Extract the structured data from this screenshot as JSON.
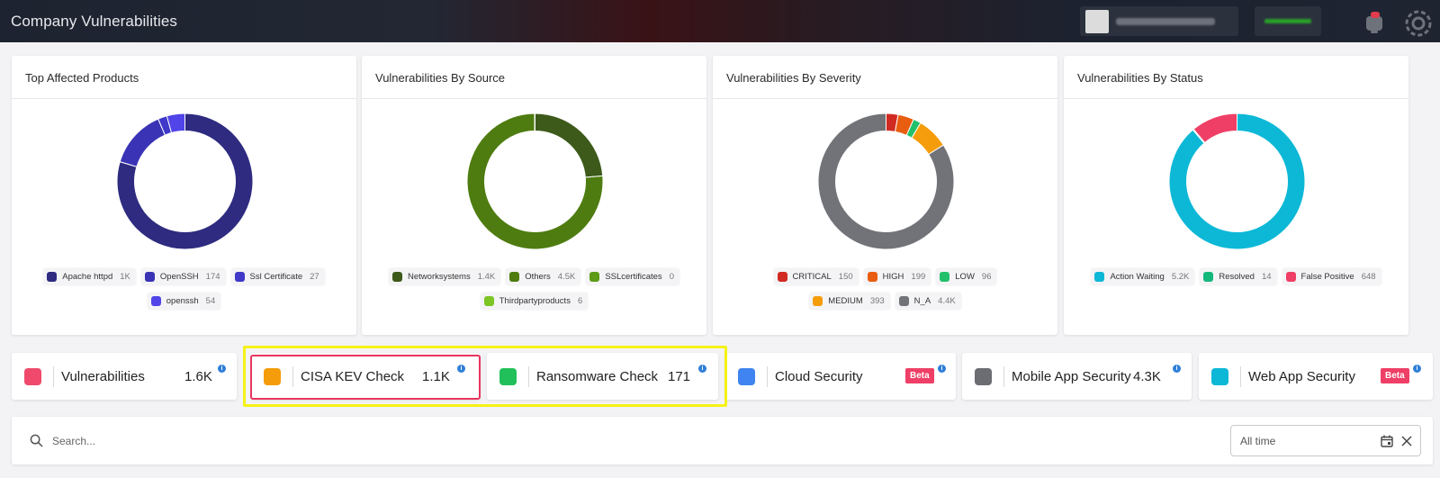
{
  "header": {
    "title": "Company Vulnerabilities"
  },
  "cards": [
    {
      "title": "Top Affected Products",
      "legend": [
        {
          "label": "Apache httpd",
          "count": "1K",
          "color": "#2e2b80"
        },
        {
          "label": "OpenSSH",
          "count": "174",
          "color": "#3a33b5"
        },
        {
          "label": "Ssl Certificate",
          "count": "27",
          "color": "#3f38c9"
        },
        {
          "label": "openssh",
          "count": "54",
          "color": "#5144e8"
        }
      ],
      "slices": [
        {
          "label": "Apache httpd",
          "value": 1000,
          "color": "#2e2b80"
        },
        {
          "label": "OpenSSH",
          "value": 174,
          "color": "#3a33b5"
        },
        {
          "label": "Ssl Certificate",
          "value": 27,
          "color": "#3f38c9"
        },
        {
          "label": "openssh",
          "value": 54,
          "color": "#5144e8"
        }
      ]
    },
    {
      "title": "Vulnerabilities By Source",
      "legend": [
        {
          "label": "Networksystems",
          "count": "1.4K",
          "color": "#3d5a1a"
        },
        {
          "label": "Others",
          "count": "4.5K",
          "color": "#4e7c10"
        },
        {
          "label": "SSLcertificates",
          "count": "0",
          "color": "#5c9a18"
        },
        {
          "label": "Thirdpartyproducts",
          "count": "6",
          "color": "#7cc524"
        }
      ],
      "slices": [
        {
          "label": "Networksystems",
          "value": 1400,
          "color": "#3d5a1a"
        },
        {
          "label": "Others",
          "value": 4500,
          "color": "#4e7c10"
        },
        {
          "label": "SSLcertificates",
          "value": 0,
          "color": "#5c9a18"
        },
        {
          "label": "Thirdpartyproducts",
          "value": 6,
          "color": "#7cc524"
        }
      ]
    },
    {
      "title": "Vulnerabilities By Severity",
      "legend": [
        {
          "label": "CRITICAL",
          "count": "150",
          "color": "#d12a22"
        },
        {
          "label": "HIGH",
          "count": "199",
          "color": "#e85d0f"
        },
        {
          "label": "LOW",
          "count": "96",
          "color": "#22c06a"
        },
        {
          "label": "MEDIUM",
          "count": "393",
          "color": "#f59c0a"
        },
        {
          "label": "N_A",
          "count": "4.4K",
          "color": "#717378"
        }
      ],
      "slices": [
        {
          "label": "CRITICAL",
          "value": 150,
          "color": "#d12a22"
        },
        {
          "label": "HIGH",
          "value": 199,
          "color": "#e85d0f"
        },
        {
          "label": "LOW",
          "value": 96,
          "color": "#22c06a"
        },
        {
          "label": "MEDIUM",
          "value": 393,
          "color": "#f59c0a"
        },
        {
          "label": "N_A",
          "value": 4400,
          "color": "#717378"
        }
      ]
    },
    {
      "title": "Vulnerabilities By Status",
      "legend": [
        {
          "label": "Action Waiting",
          "count": "5.2K",
          "color": "#0cb8d6"
        },
        {
          "label": "Resolved",
          "count": "14",
          "color": "#14b87a"
        },
        {
          "label": "False Positive",
          "count": "648",
          "color": "#ef3f66"
        }
      ],
      "slices": [
        {
          "label": "Action Waiting",
          "value": 5200,
          "color": "#0cb8d6"
        },
        {
          "label": "Resolved",
          "value": 14,
          "color": "#14b87a"
        },
        {
          "label": "False Positive",
          "value": 648,
          "color": "#ef3f66"
        }
      ]
    }
  ],
  "tiles": [
    {
      "label": "Vulnerabilities",
      "value": "1.6K",
      "color": "#ef4a6b",
      "info": true
    },
    {
      "label": "CISA KEV Check",
      "value": "1.1K",
      "color": "#f59c0a",
      "info": true
    },
    {
      "label": "Ransomware Check",
      "value": "171",
      "color": "#22c05a",
      "info": true
    },
    {
      "label": "Cloud Security",
      "badge": "Beta",
      "color": "#3f84f0",
      "info": true
    },
    {
      "label": "Mobile App Security",
      "value": "4.3K",
      "color": "#6b6d72",
      "info": true
    },
    {
      "label": "Web App Security",
      "badge": "Beta",
      "color": "#0cb8d6",
      "info": true
    }
  ],
  "search": {
    "placeholder": "Search..."
  },
  "date_filter": {
    "value": "All time"
  },
  "info_glyph": "i"
}
